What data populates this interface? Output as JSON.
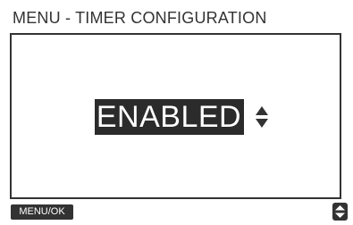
{
  "screen": {
    "title": "MENU - TIMER CONFIGURATION"
  },
  "setting": {
    "value": "ENABLED",
    "adjust_icon": "up-down-arrows-icon"
  },
  "footer": {
    "menu_ok_label": "MENU/OK",
    "scroll_icon": "up-down-arrows-icon"
  },
  "colors": {
    "background": "#ffffff",
    "foreground": "#333333",
    "highlight_bg": "#2b2b2b",
    "highlight_fg": "#ffffff"
  }
}
